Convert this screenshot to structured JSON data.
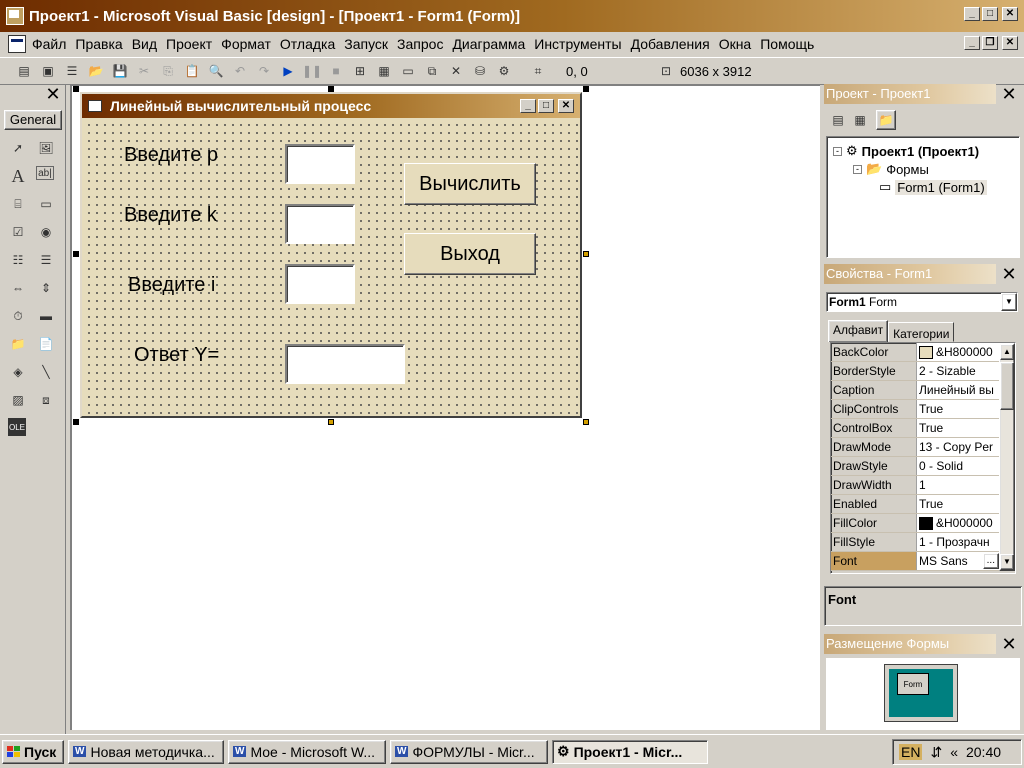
{
  "window": {
    "title": "Проект1 - Microsoft Visual Basic [design] - [Проект1 - Form1 (Form)]"
  },
  "menu": [
    "Файл",
    "Правка",
    "Вид",
    "Проект",
    "Формат",
    "Отладка",
    "Запуск",
    "Запрос",
    "Диаграмма",
    "Инструменты",
    "Добавления",
    "Окна",
    "Помощь"
  ],
  "toolbar": {
    "position": "0, 0",
    "size": "6036 x 3912"
  },
  "toolbox": {
    "tab_label": "General"
  },
  "form": {
    "title": "Линейный вычислительный процесс",
    "label_p": "Введите p",
    "label_k": "Введите k",
    "label_i": "Введите i",
    "label_y": "Ответ Y=",
    "btn_calc": "Вычислить",
    "btn_exit": "Выход"
  },
  "project_panel": {
    "title": "Проект - Проект1",
    "root": "Проект1 (Проект1)",
    "folder": "Формы",
    "item": "Form1 (Form1)"
  },
  "properties_panel": {
    "title": "Свойства - Form1",
    "object_bold": "Form1",
    "object_type": "Form",
    "tab_alpha": "Алфавит",
    "tab_cat": "Категории",
    "rows": [
      {
        "name": "BackColor",
        "value": "&H800000",
        "swatch": "#e6dcbc"
      },
      {
        "name": "BorderStyle",
        "value": "2 - Sizable"
      },
      {
        "name": "Caption",
        "value": "Линейный вы"
      },
      {
        "name": "ClipControls",
        "value": "True"
      },
      {
        "name": "ControlBox",
        "value": "True"
      },
      {
        "name": "DrawMode",
        "value": "13 - Copy Per"
      },
      {
        "name": "DrawStyle",
        "value": "0 - Solid"
      },
      {
        "name": "DrawWidth",
        "value": "1"
      },
      {
        "name": "Enabled",
        "value": "True"
      },
      {
        "name": "FillColor",
        "value": "&H000000",
        "swatch": "#000000"
      },
      {
        "name": "FillStyle",
        "value": "1 - Прозрачн"
      },
      {
        "name": "Font",
        "value": "MS Sans"
      }
    ],
    "description": "Font"
  },
  "layout_panel": {
    "title": "Размещение Формы",
    "mini_form_label": "Form"
  },
  "taskbar": {
    "start": "Пуск",
    "items": [
      "Новая методичка...",
      "Мое - Microsoft W...",
      "ФОРМУЛЫ - Micr...",
      "Проект1 - Micr..."
    ],
    "lang": "EN",
    "clock": "20:40"
  }
}
